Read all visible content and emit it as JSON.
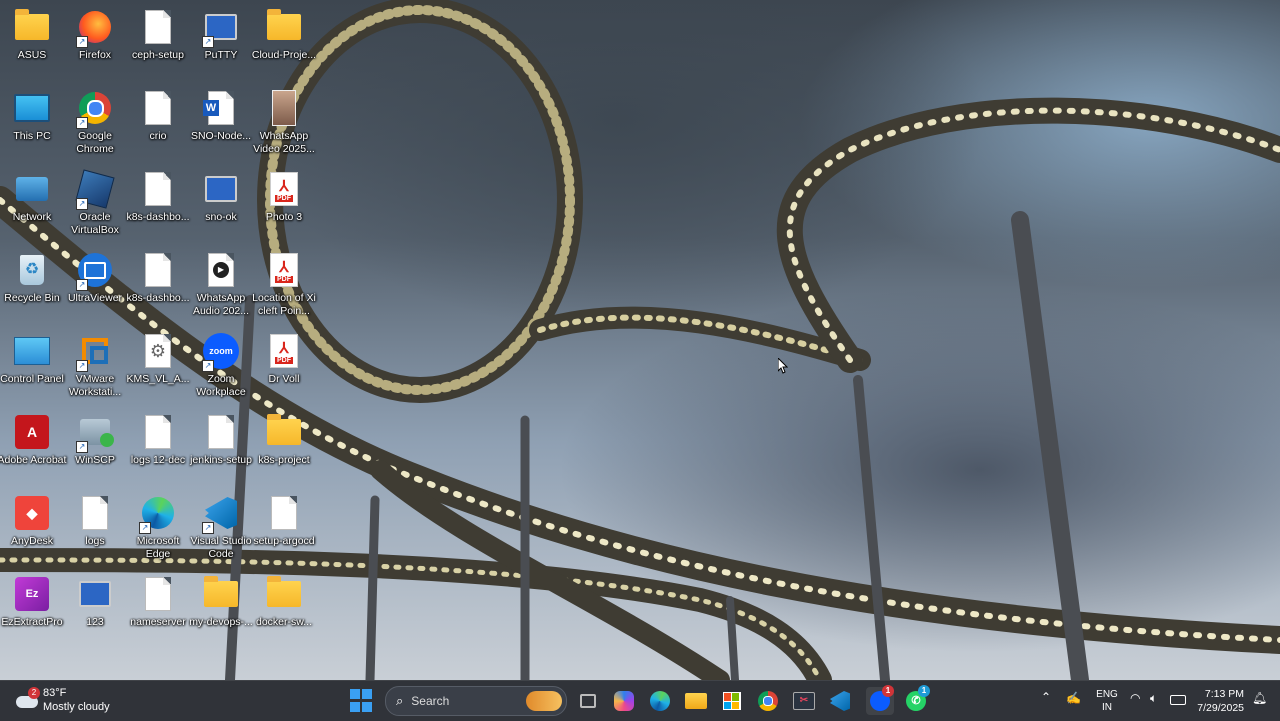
{
  "desktop_icons": [
    {
      "label": "ASUS"
    },
    {
      "label": "This PC"
    },
    {
      "label": "Network"
    },
    {
      "label": "Recycle Bin"
    },
    {
      "label": "Control Panel"
    },
    {
      "label": "Adobe Acrobat"
    },
    {
      "label": "AnyDesk"
    },
    {
      "label": "EzExtractPro"
    },
    {
      "label": "Firefox"
    },
    {
      "label": "Google Chrome"
    },
    {
      "label": "Oracle VirtualBox"
    },
    {
      "label": "UltraViewer"
    },
    {
      "label": "VMware Workstati..."
    },
    {
      "label": "WinSCP"
    },
    {
      "label": "logs"
    },
    {
      "label": "123"
    },
    {
      "label": "ceph-setup"
    },
    {
      "label": "crio"
    },
    {
      "label": "k8s-dashbo..."
    },
    {
      "label": "k8s-dashbo..."
    },
    {
      "label": "KMS_VL_A..."
    },
    {
      "label": "logs 12-dec"
    },
    {
      "label": "Microsoft Edge"
    },
    {
      "label": "nameserver"
    },
    {
      "label": "PuTTY"
    },
    {
      "label": "SNO-Node..."
    },
    {
      "label": "sno-ok"
    },
    {
      "label": "WhatsApp Audio 202..."
    },
    {
      "label": "Zoom Workplace"
    },
    {
      "label": "jenkins-setup"
    },
    {
      "label": "Visual Studio Code"
    },
    {
      "label": "my-devops-..."
    },
    {
      "label": "Cloud-Proje..."
    },
    {
      "label": "WhatsApp Video 2025..."
    },
    {
      "label": "Photo 3"
    },
    {
      "label": "Location of Xi cleft Poin..."
    },
    {
      "label": "Dr Voll"
    },
    {
      "label": "k8s-project"
    },
    {
      "label": "setup-argocd"
    },
    {
      "label": "docker-sw..."
    }
  ],
  "weather": {
    "temp": "83°F",
    "condition": "Mostly cloudy",
    "badge": "2"
  },
  "search": {
    "label": "Search"
  },
  "taskbar_apps": [
    {
      "name": "Task View"
    },
    {
      "name": "Copilot"
    },
    {
      "name": "Microsoft Edge"
    },
    {
      "name": "File Explorer"
    },
    {
      "name": "Microsoft Store"
    },
    {
      "name": "Google Chrome"
    },
    {
      "name": "Snipping Tool"
    },
    {
      "name": "Visual Studio Code"
    },
    {
      "name": "Zoom Workplace",
      "badge": "1"
    },
    {
      "name": "WhatsApp",
      "badge": "1"
    }
  ],
  "tray": {
    "lang_line1": "ENG",
    "lang_line2": "IN",
    "time": "7:13 PM",
    "date": "7/29/2025"
  }
}
